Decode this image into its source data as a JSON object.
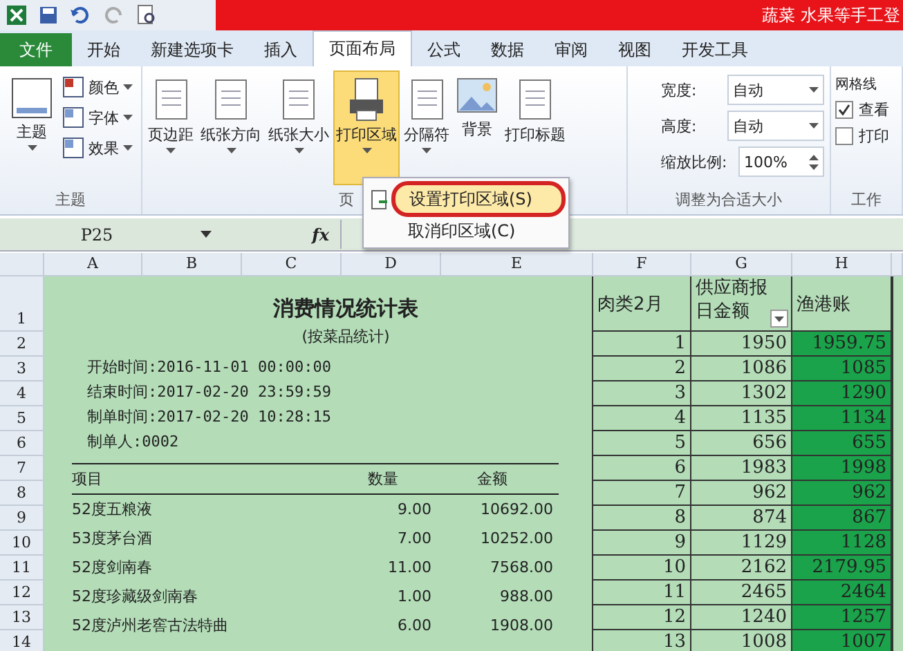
{
  "window": {
    "title": "蔬菜 水果等手工登"
  },
  "tabs": [
    {
      "label": "文件",
      "kind": "file",
      "selected": false
    },
    {
      "label": "开始",
      "kind": "tab",
      "selected": false
    },
    {
      "label": "新建选项卡",
      "kind": "tab",
      "selected": false
    },
    {
      "label": "插入",
      "kind": "tab",
      "selected": false
    },
    {
      "label": "页面布局",
      "kind": "tab",
      "selected": true
    },
    {
      "label": "公式",
      "kind": "tab",
      "selected": false
    },
    {
      "label": "数据",
      "kind": "tab",
      "selected": false
    },
    {
      "label": "审阅",
      "kind": "tab",
      "selected": false
    },
    {
      "label": "视图",
      "kind": "tab",
      "selected": false
    },
    {
      "label": "开发工具",
      "kind": "tab",
      "selected": false
    }
  ],
  "ribbon": {
    "theme_group": {
      "label": "主题",
      "big": "主题",
      "small": [
        "颜色",
        "字体",
        "效果"
      ]
    },
    "page_group": {
      "label": "页",
      "buttons": [
        {
          "label": "页边距",
          "kind": "margin",
          "selected": false
        },
        {
          "label": "纸张方向",
          "kind": "orient",
          "selected": false
        },
        {
          "label": "纸张大小",
          "kind": "size",
          "selected": false
        },
        {
          "label": "打印区域",
          "kind": "print",
          "selected": true
        },
        {
          "label": "分隔符",
          "kind": "break",
          "selected": false
        },
        {
          "label": "背景",
          "kind": "bg",
          "selected": false
        },
        {
          "label": "打印标题",
          "kind": "titles",
          "selected": false
        }
      ]
    },
    "fit_group": {
      "label": "调整为合适大小",
      "width_label": "宽度:",
      "width_value": "自动",
      "height_label": "高度:",
      "height_value": "自动",
      "scale_label": "缩放比例:",
      "scale_value": "100%"
    },
    "sheet_group": {
      "label": "工作",
      "heading": "网格线",
      "options": [
        {
          "label": "查看",
          "checked": true
        },
        {
          "label": "打印",
          "checked": false
        }
      ]
    }
  },
  "menu": {
    "items": [
      {
        "label": "设置打印区域(S)",
        "selected": true
      },
      {
        "label": "取消印区域(C)",
        "selected": false
      }
    ]
  },
  "formula_bar": {
    "name_box": "P25",
    "fx": "fx"
  },
  "columns": [
    "A",
    "B",
    "C",
    "D",
    "E",
    "F",
    "G",
    "H"
  ],
  "row_numbers": [
    "1",
    "2",
    "3",
    "4",
    "5",
    "6",
    "7",
    "8",
    "9",
    "10",
    "11",
    "12",
    "13",
    "14"
  ],
  "report": {
    "title": "消费情况统计表",
    "subtitle": "(按菜品统计)",
    "info": [
      "开始时间:2016-11-01 00:00:00",
      "结束时间:2017-02-20 23:59:59",
      "制单时间:2017-02-20 10:28:15",
      "制单人:0002"
    ],
    "columns": [
      "项目",
      "数量",
      "金额"
    ],
    "rows": [
      [
        "52度五粮液",
        "9.00",
        "10692.00"
      ],
      [
        "53度茅台酒",
        "7.00",
        "10252.00"
      ],
      [
        "52度剑南春",
        "11.00",
        "7568.00"
      ],
      [
        "52度珍藏级剑南春",
        "1.00",
        "988.00"
      ],
      [
        "52度泸州老窖古法特曲",
        "6.00",
        "1908.00"
      ]
    ]
  },
  "right_table": {
    "headers": [
      "肉类2月",
      "供应商报日金额",
      "渔港账"
    ],
    "rows": [
      [
        "1",
        "1950",
        "1959.75"
      ],
      [
        "2",
        "1086",
        "1085"
      ],
      [
        "3",
        "1302",
        "1290"
      ],
      [
        "4",
        "1135",
        "1134"
      ],
      [
        "5",
        "656",
        "655"
      ],
      [
        "6",
        "1983",
        "1998"
      ],
      [
        "7",
        "962",
        "962"
      ],
      [
        "8",
        "874",
        "867"
      ],
      [
        "9",
        "1129",
        "1128"
      ],
      [
        "10",
        "2162",
        "2179.95"
      ],
      [
        "11",
        "2465",
        "2464"
      ],
      [
        "12",
        "1240",
        "1257"
      ],
      [
        "13",
        "1008",
        "1007"
      ]
    ]
  }
}
